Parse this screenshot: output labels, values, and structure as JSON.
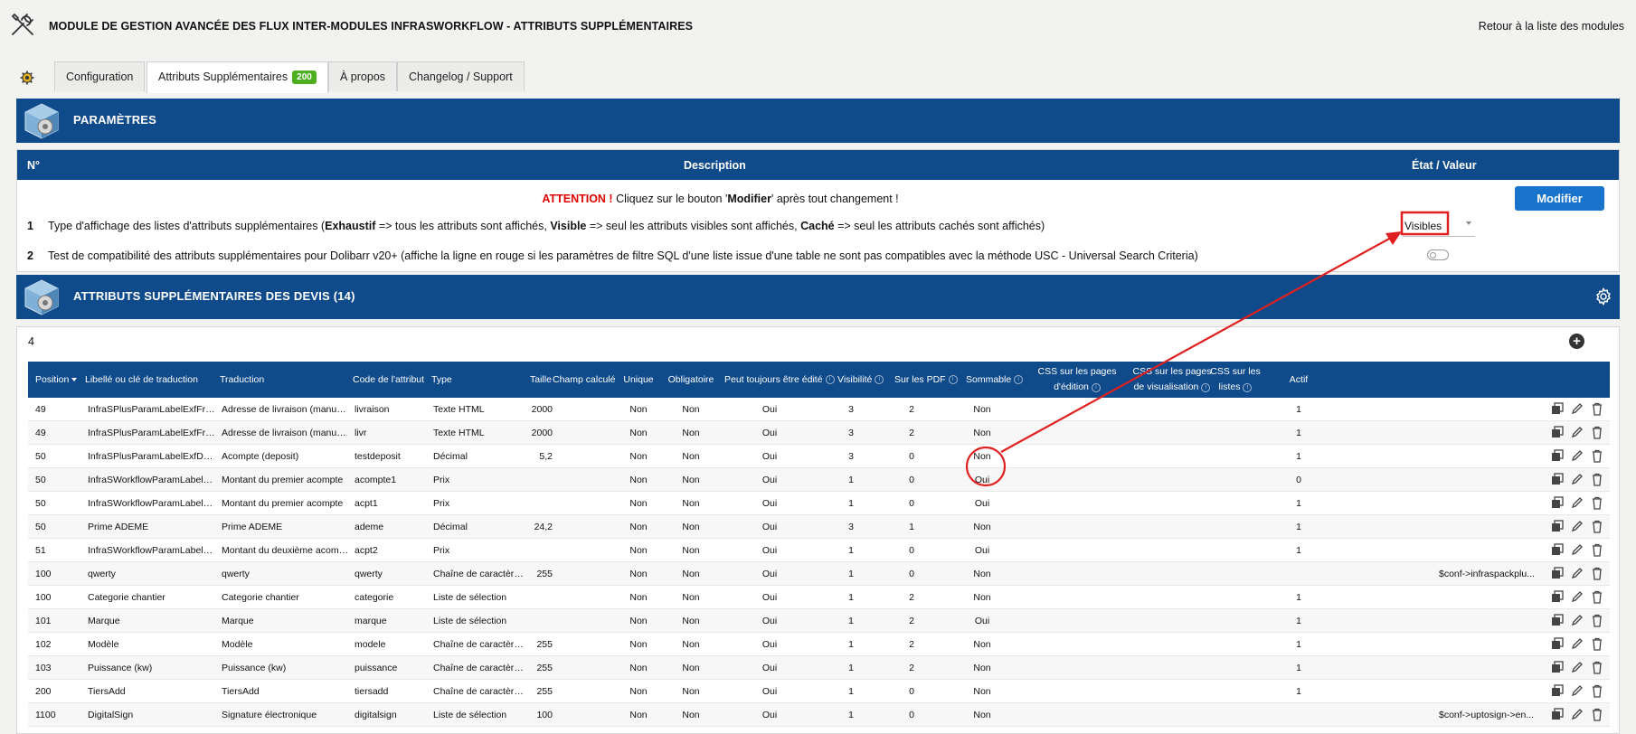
{
  "header": {
    "title": "MODULE DE GESTION AVANCÉE DES FLUX INTER-MODULES INFRASWORKFLOW - ATTRIBUTS SUPPLÉMENTAIRES",
    "back_link": "Retour à la liste des modules"
  },
  "tabs": [
    {
      "label": "Configuration"
    },
    {
      "label": "Attributs Supplémentaires",
      "badge": "200"
    },
    {
      "label": "À propos"
    },
    {
      "label": "Changelog / Support"
    }
  ],
  "params_section": {
    "title": "PARAMÈTRES",
    "col_num": "N°",
    "col_desc": "Description",
    "col_state": "État / Valeur",
    "attention_strong": "ATTENTION !",
    "attention_pre": " Cliquez sur le bouton '",
    "attention_btn": "Modifier",
    "attention_post": "' après tout changement !",
    "modify_button": "Modifier",
    "row1": {
      "num": "1",
      "t1": "Type d'affichage des listes d'attributs supplémentaires (",
      "b1": "Exhaustif",
      "t2": " => tous les attributs sont affichés, ",
      "b2": "Visible",
      "t3": " => seul les attributs visibles sont affichés, ",
      "b3": "Caché",
      "t4": " => seul les attributs cachés sont affichés)",
      "select_value": "Visibles"
    },
    "row2": {
      "num": "2",
      "desc": "Test de compatibilité des attributs supplémentaires pour Dolibarr v20+ (affiche la ligne en rouge si les paramètres de filtre SQL d'une liste issue d'une table ne sont pas compatibles avec la méthode USC - Universal Search Criteria)",
      "toggle_on": false
    }
  },
  "attrs_section": {
    "title": "ATTRIBUTS SUPPLÉMENTAIRES DES DEVIS (14)",
    "count": "4",
    "columns": {
      "position": "Position",
      "label": "Libellé ou clé de traduction",
      "translation": "Traduction",
      "code": "Code de l'attribut",
      "type": "Type",
      "size": "Taille",
      "computed": "Champ calculé",
      "unique": "Unique",
      "required": "Obligatoire",
      "always_editable": "Peut toujours être édité",
      "visibility": "Visibilité",
      "on_pdf": "Sur les PDF",
      "summable": "Sommable",
      "css_edit_1": "CSS sur les pages",
      "css_edit_2": "d'édition",
      "css_view_1": "CSS sur les pages",
      "css_view_2": "de visualisation",
      "css_list_1": "CSS sur les",
      "css_list_2": "listes",
      "active": "Actif"
    },
    "rows": [
      {
        "position": "49",
        "label": "InfraSPlusParamLabelExfFreeAd...",
        "translation": "Adresse de livraison (manuelle)",
        "code": "livraison",
        "type": "Texte HTML",
        "size": "2000",
        "unique": "Non",
        "required": "Non",
        "always_editable": "Oui",
        "visibility": "3",
        "on_pdf": "2",
        "summable": "Non",
        "css_list": "",
        "active": "1"
      },
      {
        "position": "49",
        "label": "InfraSPlusParamLabelExfFreeAd...",
        "translation": "Adresse de livraison (manuelle)",
        "code": "livr",
        "type": "Texte HTML",
        "size": "2000",
        "unique": "Non",
        "required": "Non",
        "always_editable": "Oui",
        "visibility": "3",
        "on_pdf": "2",
        "summable": "Non",
        "css_list": "",
        "active": "1"
      },
      {
        "position": "50",
        "label": "InfraSPlusParamLabelExfDeposit",
        "translation": "Acompte (deposit)",
        "code": "testdeposit",
        "type": "Décimal",
        "size": "5,2",
        "unique": "Non",
        "required": "Non",
        "always_editable": "Oui",
        "visibility": "3",
        "on_pdf": "0",
        "summable": "Non",
        "css_list": "",
        "active": "1"
      },
      {
        "position": "50",
        "label": "InfraSWorkflowParamLabelExfDe...",
        "translation": "Montant du premier acompte",
        "code": "acompte1",
        "type": "Prix",
        "size": "",
        "unique": "Non",
        "required": "Non",
        "always_editable": "Oui",
        "visibility": "1",
        "on_pdf": "0",
        "summable": "Oui",
        "css_list": "",
        "active": "0"
      },
      {
        "position": "50",
        "label": "InfraSWorkflowParamLabelExfDe...",
        "translation": "Montant du premier acompte",
        "code": "acpt1",
        "type": "Prix",
        "size": "",
        "unique": "Non",
        "required": "Non",
        "always_editable": "Oui",
        "visibility": "1",
        "on_pdf": "0",
        "summable": "Oui",
        "css_list": "",
        "active": "1"
      },
      {
        "position": "50",
        "label": "Prime ADEME",
        "translation": "Prime ADEME",
        "code": "ademe",
        "type": "Décimal",
        "size": "24,2",
        "unique": "Non",
        "required": "Non",
        "always_editable": "Oui",
        "visibility": "3",
        "on_pdf": "1",
        "summable": "Non",
        "css_list": "",
        "active": "1"
      },
      {
        "position": "51",
        "label": "InfraSWorkflowParamLabelExfSe...",
        "translation": "Montant du deuxième acompte",
        "code": "acpt2",
        "type": "Prix",
        "size": "",
        "unique": "Non",
        "required": "Non",
        "always_editable": "Oui",
        "visibility": "1",
        "on_pdf": "0",
        "summable": "Oui",
        "css_list": "",
        "active": "1"
      },
      {
        "position": "100",
        "label": "qwerty",
        "translation": "qwerty",
        "code": "qwerty",
        "type": "Chaîne de caractère...",
        "size": "255",
        "unique": "Non",
        "required": "Non",
        "always_editable": "Oui",
        "visibility": "1",
        "on_pdf": "0",
        "summable": "Non",
        "css_list": "$conf->infraspackplu...",
        "active": ""
      },
      {
        "position": "100",
        "label": "Categorie chantier",
        "translation": "Categorie chantier",
        "code": "categorie",
        "type": "Liste de sélection",
        "size": "",
        "unique": "Non",
        "required": "Non",
        "always_editable": "Oui",
        "visibility": "1",
        "on_pdf": "2",
        "summable": "Non",
        "css_list": "",
        "active": "1"
      },
      {
        "position": "101",
        "label": "Marque",
        "translation": "Marque",
        "code": "marque",
        "type": "Liste de sélection",
        "size": "",
        "unique": "Non",
        "required": "Non",
        "always_editable": "Oui",
        "visibility": "1",
        "on_pdf": "2",
        "summable": "Oui",
        "css_list": "",
        "active": "1"
      },
      {
        "position": "102",
        "label": "Modèle",
        "translation": "Modèle",
        "code": "modele",
        "type": "Chaîne de caractère...",
        "size": "255",
        "unique": "Non",
        "required": "Non",
        "always_editable": "Oui",
        "visibility": "1",
        "on_pdf": "2",
        "summable": "Non",
        "css_list": "",
        "active": "1"
      },
      {
        "position": "103",
        "label": "Puissance (kw)",
        "translation": "Puissance (kw)",
        "code": "puissance",
        "type": "Chaîne de caractère...",
        "size": "255",
        "unique": "Non",
        "required": "Non",
        "always_editable": "Oui",
        "visibility": "1",
        "on_pdf": "2",
        "summable": "Non",
        "css_list": "",
        "active": "1"
      },
      {
        "position": "200",
        "label": "TiersAdd",
        "translation": "TiersAdd",
        "code": "tiersadd",
        "type": "Chaîne de caractère...",
        "size": "255",
        "unique": "Non",
        "required": "Non",
        "always_editable": "Oui",
        "visibility": "1",
        "on_pdf": "0",
        "summable": "Non",
        "css_list": "",
        "active": "1"
      },
      {
        "position": "1100",
        "label": "DigitalSign",
        "translation": "Signature électronique",
        "code": "digitalsign",
        "type": "Liste de sélection",
        "size": "100",
        "unique": "Non",
        "required": "Non",
        "always_editable": "Oui",
        "visibility": "1",
        "on_pdf": "0",
        "summable": "Non",
        "css_list": "$conf->uptosign->en...",
        "active": ""
      }
    ]
  },
  "colors": {
    "header_blue": "#0f4a8a",
    "button_blue": "#1873cc",
    "badge_green": "#4caf1f",
    "annotation_red": "#e02020"
  }
}
